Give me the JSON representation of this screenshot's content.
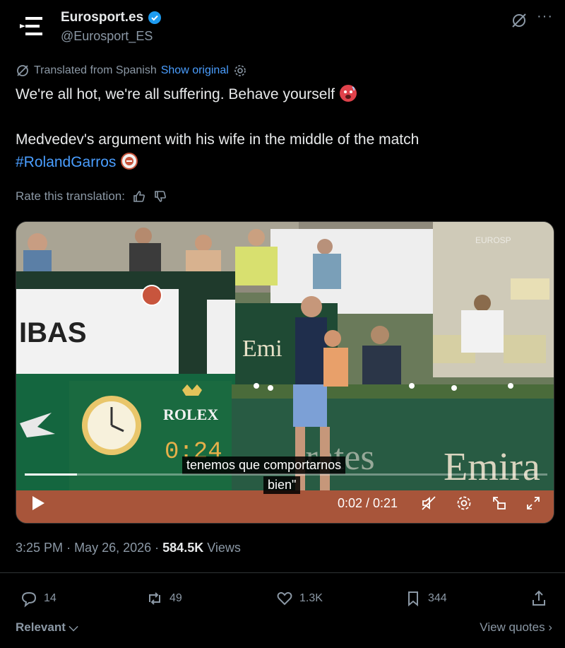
{
  "author": {
    "display_name": "Eurosport.es",
    "handle": "@Eurosport_ES",
    "verified": true
  },
  "translation": {
    "label": "Translated from Spanish",
    "show_original": "Show original"
  },
  "tweet": {
    "line1": "We're all hot, we're all suffering. Behave yourself",
    "line2": "Medvedev's argument with his wife in the middle of the match",
    "hashtag": "#RolandGarros"
  },
  "rate": {
    "label": "Rate this translation:"
  },
  "video": {
    "subtitle_line1": "tenemos que comportarnos",
    "subtitle_line2": "bien\"",
    "time": "0:02 / 0:21",
    "progress": 0.1,
    "scene_text": {
      "sponsor_left": "IBAS",
      "rolex": "ROLEX",
      "clock": "0:24",
      "emirates_banner": "Emira",
      "emirates_small": "Emi",
      "emirates_faded": "irates",
      "watermark": "EUROSP"
    }
  },
  "meta": {
    "time": "3:25 PM",
    "date": "May 26, 2026",
    "views_count": "584.5K",
    "views_label": "Views"
  },
  "actions": {
    "replies": "14",
    "reposts": "49",
    "likes": "1.3K",
    "bookmarks": "344"
  },
  "footer": {
    "relevant": "Relevant",
    "view_quotes": "View quotes"
  },
  "colors": {
    "accent": "#4a9eff",
    "muted": "#8b98a5",
    "text": "#e7e9ea",
    "background": "#000000"
  }
}
